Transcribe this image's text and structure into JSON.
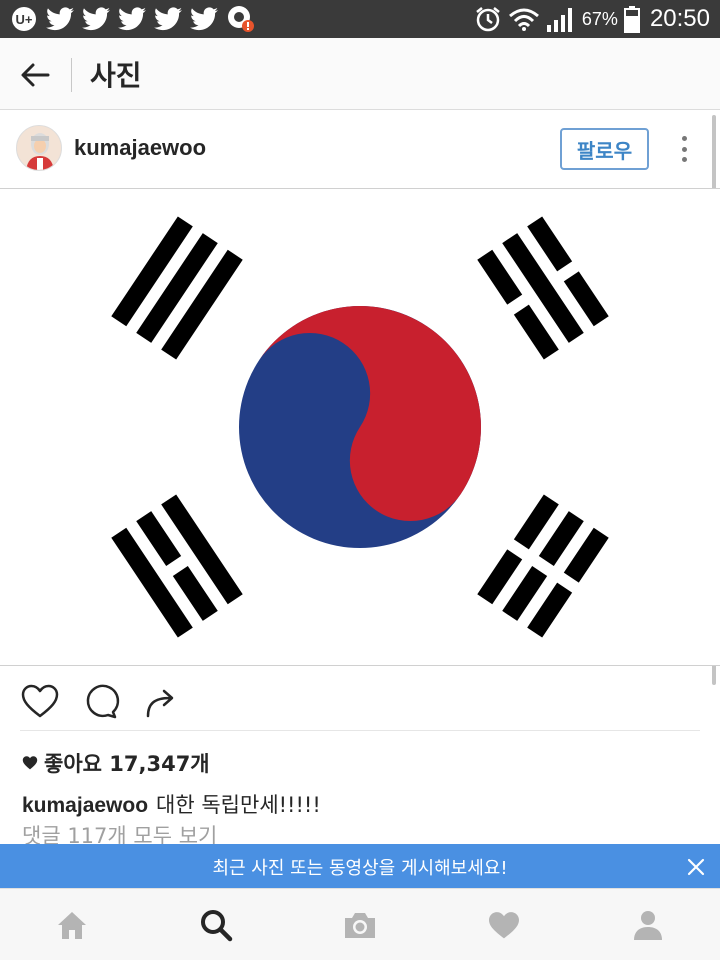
{
  "status_bar": {
    "left_icons": [
      "uplus-icon",
      "twitter-icon",
      "twitter-icon",
      "twitter-icon",
      "twitter-icon",
      "twitter-icon",
      "notification-alert-icon"
    ],
    "right_icons": [
      "alarm-icon",
      "wifi-icon",
      "signal-icon",
      "battery-icon"
    ],
    "battery_percent": "67%",
    "time": "20:50"
  },
  "app_bar": {
    "title": "사진",
    "back_icon": "back-arrow-icon"
  },
  "post": {
    "username": "kumajaewoo",
    "follow_label": "팔로우",
    "likes_text": "좋아요 17,347개",
    "caption_user": "kumajaewoo",
    "caption_text": "대한 독립만세!!!!!",
    "comments_link": "댓글 117개 모두 보기",
    "image": "south-korea-flag",
    "colors": {
      "red": "#c8202e",
      "blue": "#233e86",
      "black": "#000000"
    }
  },
  "actions": [
    "heart-icon",
    "comment-icon",
    "share-icon"
  ],
  "banner": {
    "text": "최근 사진 또는 동영상을 게시해보세요!",
    "close_icon": "close-icon",
    "color": "#4a90e2"
  },
  "bottom_nav": [
    "home-icon",
    "search-icon",
    "camera-icon",
    "heart-icon",
    "profile-icon"
  ]
}
